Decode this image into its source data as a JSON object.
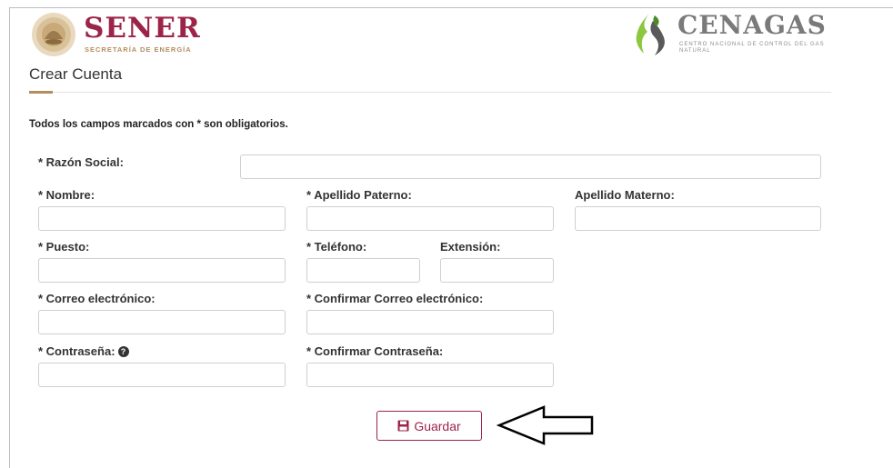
{
  "header": {
    "sener_name": "SENER",
    "sener_subtitle": "SECRETARÍA DE ENERGÍA",
    "cenagas_name": "CENAGAS",
    "cenagas_subtitle": "CENTRO NACIONAL DE CONTROL DEL GAS NATURAL"
  },
  "page": {
    "title": "Crear Cuenta",
    "required_note": "Todos los campos marcados con * son obligatorios."
  },
  "form": {
    "razon_social_label": "* Razón Social:",
    "nombre_label": "* Nombre:",
    "apellido_paterno_label": "* Apellido Paterno:",
    "apellido_materno_label": "Apellido Materno:",
    "puesto_label": "* Puesto:",
    "telefono_label": "* Teléfono:",
    "extension_label": "Extensión:",
    "correo_label": "* Correo electrónico:",
    "confirmar_correo_label": "* Confirmar Correo electrónico:",
    "contrasena_label": "* Contraseña:",
    "confirmar_contrasena_label": "* Confirmar Contraseña:",
    "razon_social_value": "",
    "nombre_value": "",
    "apellido_paterno_value": "",
    "apellido_materno_value": "",
    "puesto_value": "",
    "telefono_value": "",
    "extension_value": "",
    "correo_value": "",
    "confirmar_correo_value": "",
    "contrasena_value": "",
    "confirmar_contrasena_value": ""
  },
  "actions": {
    "save_label": "Guardar",
    "save_icon": "floppy-disk-icon",
    "annotation_icon": "left-arrow-outline-icon"
  },
  "colors": {
    "brand": "#9d2449",
    "accent": "#b38e5d"
  }
}
